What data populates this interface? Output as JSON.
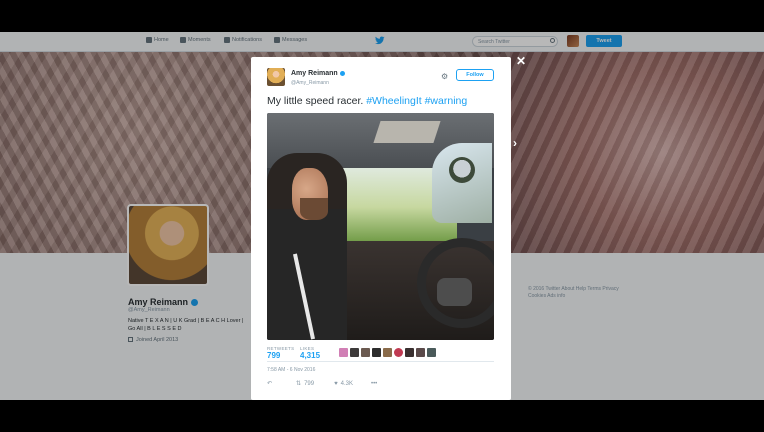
{
  "nav": {
    "items": [
      {
        "label": "Home",
        "icon": "home-icon"
      },
      {
        "label": "Moments",
        "icon": "lightning-icon"
      },
      {
        "label": "Notifications",
        "icon": "bell-icon"
      },
      {
        "label": "Messages",
        "icon": "envelope-icon"
      }
    ],
    "search_placeholder": "Search Twitter",
    "tweet_label": "Tweet"
  },
  "profile": {
    "name": "Amy Reimann",
    "handle": "@Amy_Reimann",
    "bio": "Native T E X A N | U K Grad | B E A C H Lover | Go All | B L E S S E D",
    "joined": "Joined April 2013"
  },
  "footer": {
    "text": "© 2016 Twitter   About   Help   Terms   Privacy   Cookies   Ads info"
  },
  "modal": {
    "name": "Amy Reimann",
    "handle": "@Amy_Reimann",
    "follow_label": "Follow",
    "text_plain": "My little speed racer. ",
    "hashtag1": "#WheelingIt",
    "hashtag2": "#warning",
    "retweets_label": "RETWEETS",
    "retweets_value": "799",
    "likes_label": "LIKES",
    "likes_value": "4,315",
    "timestamp": "7:58 AM - 6 Nov 2016",
    "action_retweet_count": "799",
    "action_like_count": "4.3K",
    "more_label": "•••"
  },
  "colors": {
    "accent": "#1da1f2",
    "text": "#292f33",
    "muted": "#8899a6"
  }
}
